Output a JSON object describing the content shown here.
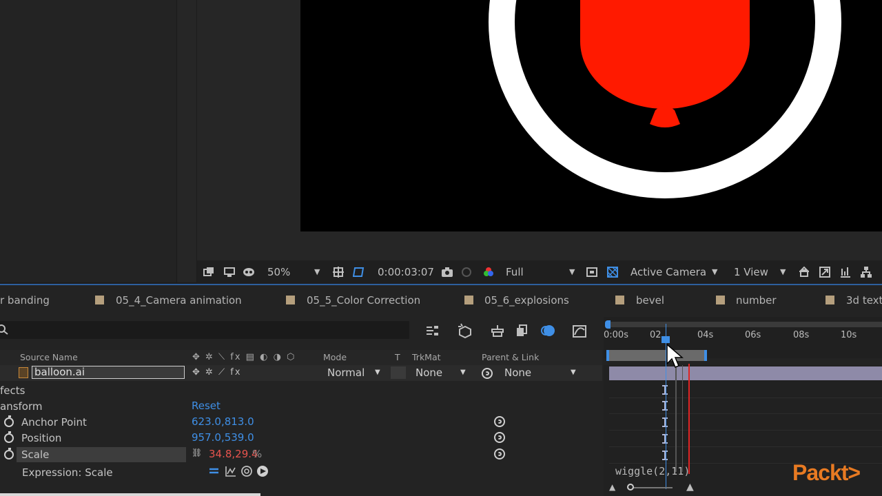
{
  "viewer": {
    "zoom": "50%",
    "timecode": "0:00:03:07",
    "resolution": "Full",
    "camera": "Active Camera",
    "views": "1 View"
  },
  "comp_tabs": [
    {
      "label": "r banding"
    },
    {
      "label": "05_4_Camera animation"
    },
    {
      "label": "05_5_Color Correction"
    },
    {
      "label": "05_6_explosions"
    },
    {
      "label": "bevel"
    },
    {
      "label": "number"
    },
    {
      "label": "3d text"
    }
  ],
  "timeline": {
    "headers": {
      "source_name": "Source Name",
      "mode": "Mode",
      "t": "T",
      "trkmat": "TrkMat",
      "parent": "Parent & Link"
    },
    "ruler": [
      "0:00s",
      "02",
      "04s",
      "06s",
      "08s",
      "10s"
    ],
    "layer": {
      "name": "balloon.ai",
      "mode": "Normal",
      "trkmat": "None",
      "parent": "None"
    },
    "effects_label": "fects",
    "transform_label": "ansform",
    "reset_label": "Reset",
    "properties": [
      {
        "name": "Anchor Point",
        "value": "623.0,813.0"
      },
      {
        "name": "Position",
        "value": "957.0,539.0"
      },
      {
        "name": "Scale",
        "value": "34.8,29.4",
        "unit": "%"
      }
    ],
    "expression_label": "Expression: Scale",
    "expression_text": "wiggle(2,11)"
  },
  "watermark": "Packt>",
  "colors": {
    "accent_blue": "#3f8fe6",
    "balloon_red": "#ff1a00",
    "tab_swatch": "#b59f7d",
    "playhead_red": "#e02424"
  }
}
